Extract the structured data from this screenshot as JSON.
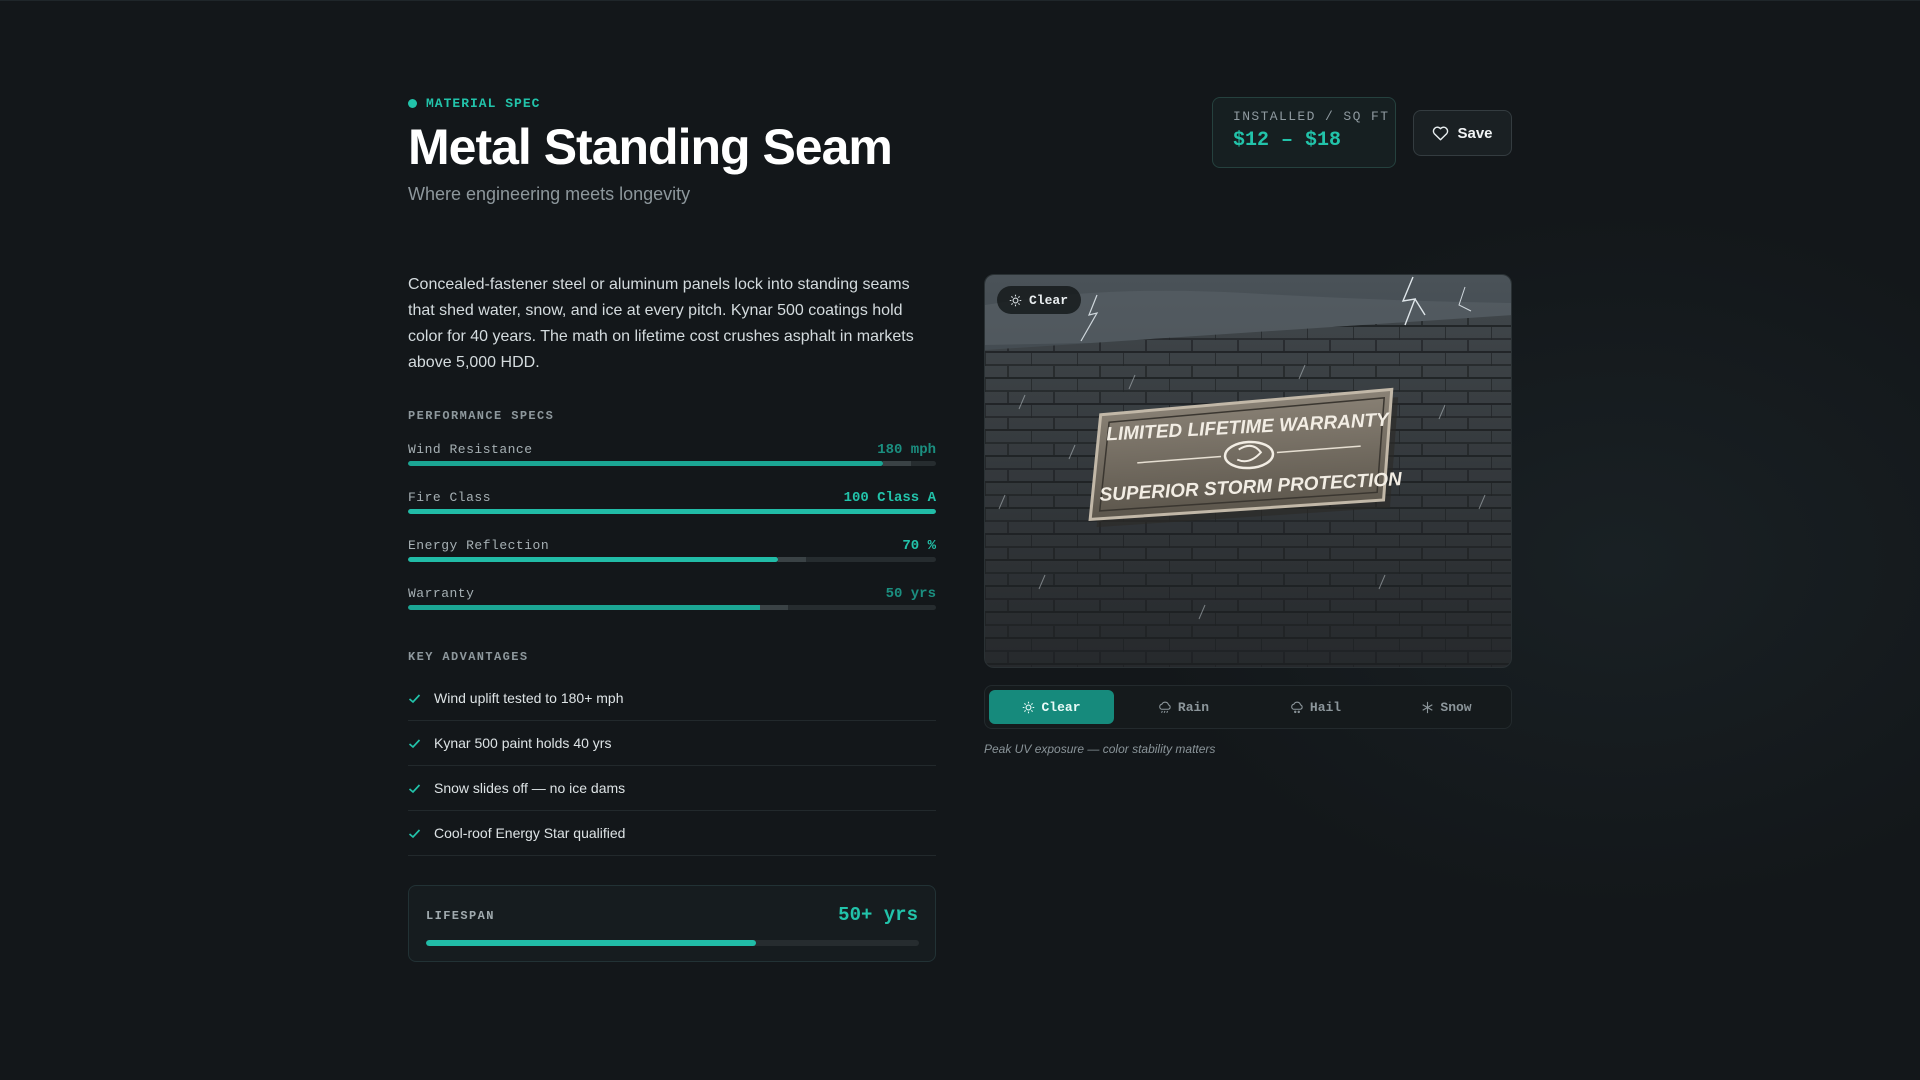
{
  "header": {
    "eyebrow": "MATERIAL SPEC",
    "title": "Metal Standing Seam",
    "subtitle": "Where engineering meets longevity"
  },
  "price": {
    "label": "INSTALLED / SQ FT",
    "value": "$12 – $18"
  },
  "save_button": {
    "label": "Save",
    "icon": "heart-icon"
  },
  "description": "Concealed-fastener steel or aluminum panels lock into standing seams that shed water, snow, and ice at every pitch. Kynar 500 coatings hold color for 40 years. The math on lifetime cost crushes asphalt in markets above 5,000 HDD.",
  "performance": {
    "label": "PERFORMANCE SPECS",
    "specs": [
      {
        "name": "Wind Resistance",
        "value": "180 mph",
        "level_percent": 90
      },
      {
        "name": "Fire Class",
        "value": "100 Class A",
        "level_percent": 100
      },
      {
        "name": "Energy Reflection",
        "value": "70 %",
        "level_percent": 70
      },
      {
        "name": "Warranty",
        "value": "50 yrs",
        "level_percent": 67
      }
    ]
  },
  "advantages": {
    "label": "KEY ADVANTAGES",
    "items": [
      "Wind uplift tested to 180+ mph",
      "Kynar 500 paint holds 40 yrs",
      "Snow slides off — no ice dams",
      "Cool-roof Energy Star qualified"
    ]
  },
  "lifespan": {
    "label": "LIFESPAN",
    "value": "50+ yrs",
    "level_percent": 67
  },
  "image": {
    "weather_chip": "Clear",
    "plaque_line1": "LIMITED LIFETIME WARRANTY",
    "plaque_line2": "SUPERIOR STORM PROTECTION"
  },
  "weather_tabs": {
    "active": "Clear",
    "tabs": [
      {
        "label": "Clear",
        "icon": "sun-icon"
      },
      {
        "label": "Rain",
        "icon": "cloud-rain-icon"
      },
      {
        "label": "Hail",
        "icon": "cloud-hail-icon"
      },
      {
        "label": "Snow",
        "icon": "snowflake-icon"
      }
    ]
  },
  "caption": "Peak UV exposure — color stability matters",
  "colors": {
    "accent": "#22c3aa",
    "background": "#13171a",
    "active_tab": "#168a7c"
  }
}
